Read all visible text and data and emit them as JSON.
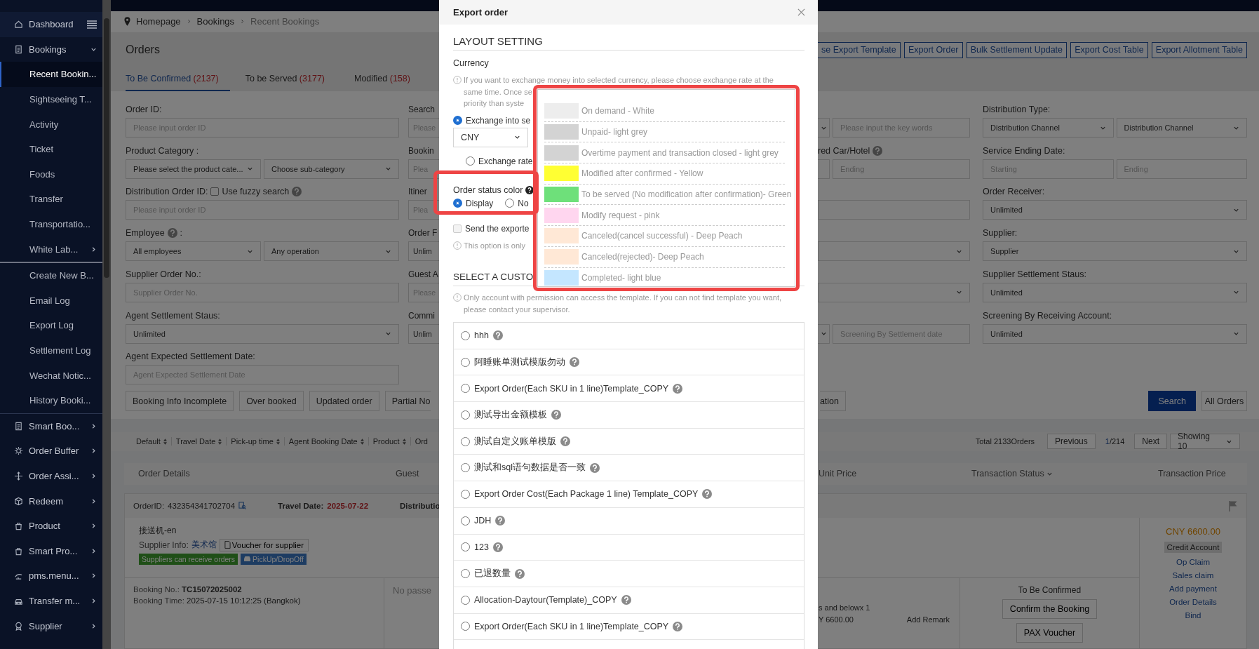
{
  "sidebar": {
    "sections": [
      {
        "items": [
          {
            "label": "Dashboard",
            "kind": "group",
            "selected": false
          },
          {
            "label": "Bookings",
            "kind": "group",
            "expanded": true,
            "selected": false
          },
          {
            "label": "Recent Bookin...",
            "kind": "child",
            "selected": true
          },
          {
            "label": "Sightseeing T...",
            "kind": "child",
            "selected": false
          },
          {
            "label": "Activity",
            "kind": "child",
            "selected": false
          },
          {
            "label": "Ticket",
            "kind": "child",
            "selected": false
          },
          {
            "label": "Foods",
            "kind": "child",
            "selected": false
          },
          {
            "label": "Transfer",
            "kind": "child",
            "selected": false
          },
          {
            "label": "Transportatio...",
            "kind": "child",
            "selected": false
          },
          {
            "label": "White Lab...",
            "kind": "child",
            "expanded": false,
            "selected": false
          }
        ]
      },
      {
        "items": [
          {
            "label": "Create New B...",
            "kind": "child",
            "selected": false
          },
          {
            "label": "Email Log",
            "kind": "child",
            "selected": false
          },
          {
            "label": "Export Log",
            "kind": "child",
            "selected": false
          },
          {
            "label": "Settlement Log",
            "kind": "child",
            "selected": false
          },
          {
            "label": "Wechat Notic...",
            "kind": "child",
            "selected": false
          },
          {
            "label": "History Booki...",
            "kind": "child",
            "selected": false
          }
        ]
      },
      {
        "items": [
          {
            "label": "Smart Boo...",
            "kind": "group",
            "expanded": false,
            "selected": false
          },
          {
            "label": "Order Buffer",
            "kind": "group",
            "expanded": false,
            "selected": false
          },
          {
            "label": "Order Assi...",
            "kind": "group",
            "expanded": false,
            "selected": false
          },
          {
            "label": "Redeem",
            "kind": "group",
            "expanded": false,
            "selected": false
          },
          {
            "label": "Product",
            "kind": "group",
            "expanded": false,
            "selected": false
          },
          {
            "label": "Smart Pro...",
            "kind": "group",
            "expanded": false,
            "selected": false
          },
          {
            "label": "pms.menu...",
            "kind": "group",
            "expanded": false,
            "selected": false
          },
          {
            "label": "Transfer m...",
            "kind": "group",
            "expanded": false,
            "selected": false
          },
          {
            "label": "Supplier",
            "kind": "group",
            "expanded": false,
            "selected": false
          }
        ]
      }
    ]
  },
  "breadcrumb": [
    "Homepage",
    "Bookings",
    "Recent Bookings"
  ],
  "page_header": {
    "title": "Orders",
    "actions": [
      "se Export Template",
      "Export Order",
      "Bulk Settlement Update",
      "Export Cost Table",
      "Export Allotment Table"
    ],
    "tabs": [
      {
        "label": "To Be Confirmed",
        "count": "(2137)",
        "selected": true
      },
      {
        "label": "To be Served",
        "count": "(3177)",
        "selected": false
      },
      {
        "label": "Modified",
        "count": "(158)",
        "selected": false
      }
    ]
  },
  "filters": {
    "columns": [
      {
        "fields": [
          {
            "label": "Order ID:",
            "controls": [
              {
                "kind": "input",
                "placeholder": "Please input order ID"
              }
            ]
          },
          {
            "label": "Product Category :",
            "controls": [
              {
                "kind": "select",
                "value": "Please select the product cate..."
              },
              {
                "kind": "select",
                "value": "Choose sub-category"
              }
            ]
          },
          {
            "label": "Distribution Order ID:",
            "help": true,
            "checkbox": {
              "label": "Use fuzzy search",
              "checked": false
            },
            "controls": [
              {
                "kind": "input",
                "placeholder": "Please input order ID"
              }
            ]
          },
          {
            "label": "Employee",
            "help": true,
            "label_suffix": ":",
            "controls": [
              {
                "kind": "select",
                "value": "All employees"
              },
              {
                "kind": "select",
                "value": "Any operation"
              }
            ]
          },
          {
            "label": "Supplier Order No.:",
            "controls": [
              {
                "kind": "input",
                "placeholder": "Supplier Order No."
              }
            ]
          },
          {
            "label": "Agent Settlement Staus:",
            "controls": [
              {
                "kind": "select",
                "value": "Unlimited"
              }
            ]
          },
          {
            "label": "Agent Expected Settlement Date:",
            "controls": [
              {
                "kind": "input",
                "placeholder": "Agent Expected Settlement Date"
              }
            ]
          }
        ]
      },
      {
        "fields": [
          {
            "label": "Search",
            "controls": [
              {
                "kind": "clipped",
                "placeholder": "Please"
              }
            ]
          },
          {
            "label": "Bookin",
            "controls": [
              {
                "kind": "clipped",
                "placeholder": "Plea"
              }
            ]
          },
          {
            "label": "Itiner",
            "controls": [
              {
                "kind": "clipped",
                "placeholder": "Plea"
              }
            ]
          },
          {
            "label": "Order F",
            "controls": [
              {
                "kind": "clipped",
                "value": "Unlim"
              }
            ]
          },
          {
            "label": "Guest A",
            "controls": [
              {
                "kind": "clipped",
                "placeholder": "Please"
              }
            ]
          },
          {
            "label": "Commi",
            "controls": [
              {
                "kind": "clipped",
                "value": "Unlim"
              }
            ]
          }
        ]
      },
      {
        "fields": [
          {
            "controls": [
              {
                "kind": "select-stub"
              },
              {
                "kind": "input",
                "placeholder": "Please input the key words"
              }
            ]
          },
          {
            "label": "red Car/Hotel",
            "help": true,
            "controls": [
              {
                "kind": "input-stub"
              },
              {
                "kind": "input",
                "placeholder": "Ending"
              }
            ]
          },
          {
            "controls": [
              {
                "kind": "input"
              }
            ]
          },
          {
            "controls": [
              {
                "kind": "select"
              }
            ]
          },
          {
            "controls": [
              {
                "kind": "select"
              }
            ]
          },
          {
            "controls": [
              {
                "kind": "select-stub"
              },
              {
                "kind": "input",
                "placeholder": "Screening By Settlement date"
              }
            ]
          }
        ]
      },
      {
        "fields": [
          {
            "label": "Distribution Type:",
            "controls": [
              {
                "kind": "select",
                "value": "Distribution Channel"
              },
              {
                "kind": "select",
                "value": "Distribution Channel"
              }
            ]
          },
          {
            "label": "Service Ending Date:",
            "controls": [
              {
                "kind": "input",
                "placeholder": "Starting"
              },
              {
                "kind": "input",
                "placeholder": "Ending"
              }
            ]
          },
          {
            "label": "Order Receiver:",
            "controls": [
              {
                "kind": "select",
                "value": "Unlimited"
              }
            ]
          },
          {
            "label": "Supplier:",
            "controls": [
              {
                "kind": "select",
                "value": "Supplier"
              }
            ]
          },
          {
            "label": "Supplier Settlement Staus:",
            "controls": [
              {
                "kind": "select",
                "value": "Unlimited"
              }
            ]
          },
          {
            "label": "Screening By Receiving Account:",
            "controls": [
              {
                "kind": "select",
                "value": "Unlimited"
              }
            ]
          }
        ]
      }
    ]
  },
  "quick_filters": {
    "left": [
      "Booking Info Incomplete",
      "Over booked",
      "Updated order",
      "Partial No"
    ],
    "right": [
      "ation"
    ]
  },
  "search_button": "Search",
  "all_orders_button": "All Orders",
  "sort_bar": {
    "sorts": [
      {
        "label": "Default",
        "sortable": true
      },
      {
        "label": "Travel Date",
        "sortable": true
      },
      {
        "label": "Pick-up time",
        "sortable": true
      },
      {
        "label": "Agent Booking Date",
        "sortable": true
      },
      {
        "label": "Product",
        "sortable": true
      },
      {
        "label": "Ord"
      }
    ],
    "total": "Total 2133Orders",
    "previous": "Previous",
    "page": "1",
    "pages": "/214",
    "next": "Next",
    "page_size": "Showing 10"
  },
  "table": {
    "columns": [
      {
        "label": "Order Details"
      },
      {
        "label": "Guest"
      },
      {
        "label": "Unit Price"
      },
      {
        "label": "Transaction Status",
        "dropdown": true
      },
      {
        "label": "Transaction Price"
      }
    ]
  },
  "order": {
    "order_id_label": "OrderID:",
    "order_id": "432354341702704",
    "travel_date_label": "Travel Date:",
    "travel_date": "2025-07-22",
    "distribution_label": "Distributio",
    "product": "接送机-en",
    "supplier_label": "Supplier Info:",
    "supplier": "美术馆",
    "voucher_button": "Voucher for supplier",
    "tags": [
      {
        "label": "Suppliers can receive orders",
        "kind": "supplier"
      },
      {
        "label": "PickUp/DropOff",
        "kind": "transport"
      }
    ],
    "price": "CNY 6600.00",
    "payment_badge": "Credit Account",
    "links": [
      "Op Claim",
      "Sales claim",
      "Add payment",
      "Order Details",
      "Bind"
    ],
    "booking_no_label": "Booking No.:",
    "booking_no": "TC15072025002",
    "booking_time_label": "Booking Time:",
    "booking_time": "2025-07-15 10:12:25 (Bangkok)",
    "guest_note": "No passe",
    "unit_lines": [
      "s and belowx 1",
      "Y 6600.00"
    ],
    "remark_link": "Add Remark",
    "status": "To Be Confirmed",
    "confirm_button": "Confirm the Booking",
    "pax_button": "PAX Voucher"
  },
  "export_modal": {
    "title": "Export order",
    "layout_heading": "LAYOUT SETTING",
    "currency_label": "Currency",
    "currency_note": [
      "If you want to exchange money into selected currency, please choose exchange rate at the",
      "same time. Once se",
      "priority than syste"
    ],
    "currency_options": [
      {
        "label": "Exchange into se",
        "selected": true
      },
      {
        "label": "Exchange rate",
        "selected": false
      }
    ],
    "currency": "CNY",
    "status_color_label": "Order status color",
    "status_color_options": [
      {
        "label": "Display",
        "selected": true
      },
      {
        "label": "No",
        "selected": false
      }
    ],
    "send_option": {
      "label": "Send the exporte",
      "checked": false
    },
    "send_note": "This option is only",
    "template_heading": "SELECT A CUSTO",
    "template_note": "Only account with permission can access the template. If you can not find template you want, please contact your supervisor.",
    "templates": [
      {
        "label": "hhh",
        "selected": false
      },
      {
        "label": "阿睡账单测试模版勿动",
        "selected": false
      },
      {
        "label": "Export Order(Each SKU in 1 line)Template_COPY",
        "selected": false
      },
      {
        "label": "测试导出金额模板",
        "selected": false
      },
      {
        "label": "测试自定义账单模版",
        "selected": false
      },
      {
        "label": "测试和sql语句数据是否一致",
        "selected": false
      },
      {
        "label": "Export Order Cost(Each Package 1 line) Template_COPY",
        "selected": false
      },
      {
        "label": "JDH",
        "selected": false
      },
      {
        "label": "123",
        "selected": false
      },
      {
        "label": "已退数量",
        "selected": false
      },
      {
        "label": "Allocation-Daytour(Template)_COPY",
        "selected": false
      },
      {
        "label": "Export Order(Each SKU in 1 line)Template_COPY",
        "selected": false
      }
    ]
  },
  "status_colors": {
    "items": [
      {
        "label": "On demand - White",
        "color": "#ededed"
      },
      {
        "label": "Unpaid- light grey",
        "color": "#d3d3d3"
      },
      {
        "label": "Overtime payment and transaction closed - light grey",
        "color": "#d3d3d3"
      },
      {
        "label": "Modified after confirmed - Yellow",
        "color": "#ffff33"
      },
      {
        "label": "To be served (No modification after confirmation)- Green",
        "color": "#6ee07a"
      },
      {
        "label": "Modify request - pink",
        "color": "#ffd6ef"
      },
      {
        "label": "Canceled(cancel successful) - Deep Peach",
        "color": "#ffe8d6"
      },
      {
        "label": "Canceled(rejected)- Deep Peach",
        "color": "#ffe8d6"
      },
      {
        "label": "Completed- light blue",
        "color": "#c4e6ff"
      }
    ]
  }
}
